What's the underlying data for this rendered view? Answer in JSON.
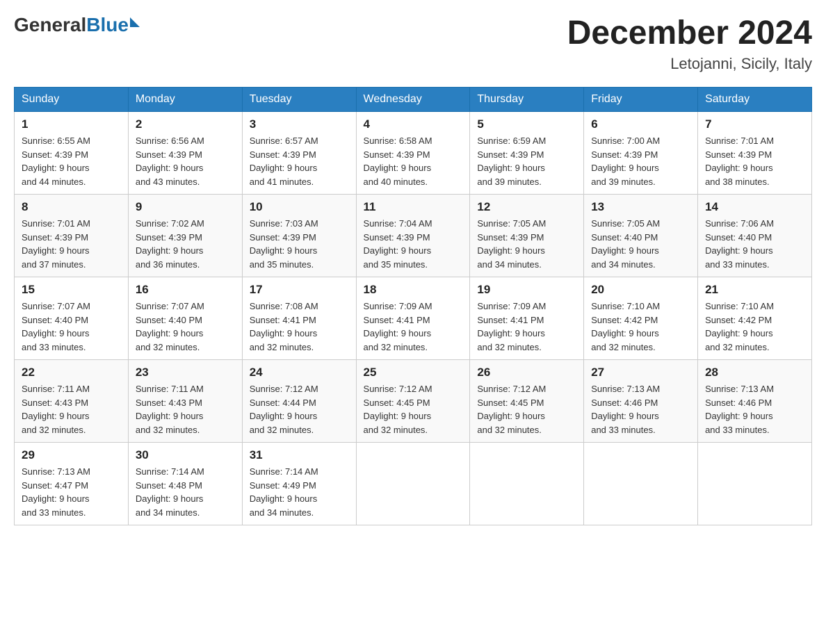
{
  "header": {
    "logo_general": "General",
    "logo_blue": "Blue",
    "month_title": "December 2024",
    "location": "Letojanni, Sicily, Italy"
  },
  "days_of_week": [
    "Sunday",
    "Monday",
    "Tuesday",
    "Wednesday",
    "Thursday",
    "Friday",
    "Saturday"
  ],
  "weeks": [
    [
      {
        "date": "1",
        "sunrise": "6:55 AM",
        "sunset": "4:39 PM",
        "daylight": "9 hours and 44 minutes."
      },
      {
        "date": "2",
        "sunrise": "6:56 AM",
        "sunset": "4:39 PM",
        "daylight": "9 hours and 43 minutes."
      },
      {
        "date": "3",
        "sunrise": "6:57 AM",
        "sunset": "4:39 PM",
        "daylight": "9 hours and 41 minutes."
      },
      {
        "date": "4",
        "sunrise": "6:58 AM",
        "sunset": "4:39 PM",
        "daylight": "9 hours and 40 minutes."
      },
      {
        "date": "5",
        "sunrise": "6:59 AM",
        "sunset": "4:39 PM",
        "daylight": "9 hours and 39 minutes."
      },
      {
        "date": "6",
        "sunrise": "7:00 AM",
        "sunset": "4:39 PM",
        "daylight": "9 hours and 39 minutes."
      },
      {
        "date": "7",
        "sunrise": "7:01 AM",
        "sunset": "4:39 PM",
        "daylight": "9 hours and 38 minutes."
      }
    ],
    [
      {
        "date": "8",
        "sunrise": "7:01 AM",
        "sunset": "4:39 PM",
        "daylight": "9 hours and 37 minutes."
      },
      {
        "date": "9",
        "sunrise": "7:02 AM",
        "sunset": "4:39 PM",
        "daylight": "9 hours and 36 minutes."
      },
      {
        "date": "10",
        "sunrise": "7:03 AM",
        "sunset": "4:39 PM",
        "daylight": "9 hours and 35 minutes."
      },
      {
        "date": "11",
        "sunrise": "7:04 AM",
        "sunset": "4:39 PM",
        "daylight": "9 hours and 35 minutes."
      },
      {
        "date": "12",
        "sunrise": "7:05 AM",
        "sunset": "4:39 PM",
        "daylight": "9 hours and 34 minutes."
      },
      {
        "date": "13",
        "sunrise": "7:05 AM",
        "sunset": "4:40 PM",
        "daylight": "9 hours and 34 minutes."
      },
      {
        "date": "14",
        "sunrise": "7:06 AM",
        "sunset": "4:40 PM",
        "daylight": "9 hours and 33 minutes."
      }
    ],
    [
      {
        "date": "15",
        "sunrise": "7:07 AM",
        "sunset": "4:40 PM",
        "daylight": "9 hours and 33 minutes."
      },
      {
        "date": "16",
        "sunrise": "7:07 AM",
        "sunset": "4:40 PM",
        "daylight": "9 hours and 32 minutes."
      },
      {
        "date": "17",
        "sunrise": "7:08 AM",
        "sunset": "4:41 PM",
        "daylight": "9 hours and 32 minutes."
      },
      {
        "date": "18",
        "sunrise": "7:09 AM",
        "sunset": "4:41 PM",
        "daylight": "9 hours and 32 minutes."
      },
      {
        "date": "19",
        "sunrise": "7:09 AM",
        "sunset": "4:41 PM",
        "daylight": "9 hours and 32 minutes."
      },
      {
        "date": "20",
        "sunrise": "7:10 AM",
        "sunset": "4:42 PM",
        "daylight": "9 hours and 32 minutes."
      },
      {
        "date": "21",
        "sunrise": "7:10 AM",
        "sunset": "4:42 PM",
        "daylight": "9 hours and 32 minutes."
      }
    ],
    [
      {
        "date": "22",
        "sunrise": "7:11 AM",
        "sunset": "4:43 PM",
        "daylight": "9 hours and 32 minutes."
      },
      {
        "date": "23",
        "sunrise": "7:11 AM",
        "sunset": "4:43 PM",
        "daylight": "9 hours and 32 minutes."
      },
      {
        "date": "24",
        "sunrise": "7:12 AM",
        "sunset": "4:44 PM",
        "daylight": "9 hours and 32 minutes."
      },
      {
        "date": "25",
        "sunrise": "7:12 AM",
        "sunset": "4:45 PM",
        "daylight": "9 hours and 32 minutes."
      },
      {
        "date": "26",
        "sunrise": "7:12 AM",
        "sunset": "4:45 PM",
        "daylight": "9 hours and 32 minutes."
      },
      {
        "date": "27",
        "sunrise": "7:13 AM",
        "sunset": "4:46 PM",
        "daylight": "9 hours and 33 minutes."
      },
      {
        "date": "28",
        "sunrise": "7:13 AM",
        "sunset": "4:46 PM",
        "daylight": "9 hours and 33 minutes."
      }
    ],
    [
      {
        "date": "29",
        "sunrise": "7:13 AM",
        "sunset": "4:47 PM",
        "daylight": "9 hours and 33 minutes."
      },
      {
        "date": "30",
        "sunrise": "7:14 AM",
        "sunset": "4:48 PM",
        "daylight": "9 hours and 34 minutes."
      },
      {
        "date": "31",
        "sunrise": "7:14 AM",
        "sunset": "4:49 PM",
        "daylight": "9 hours and 34 minutes."
      },
      null,
      null,
      null,
      null
    ]
  ],
  "labels": {
    "sunrise": "Sunrise:",
    "sunset": "Sunset:",
    "daylight": "Daylight:"
  }
}
